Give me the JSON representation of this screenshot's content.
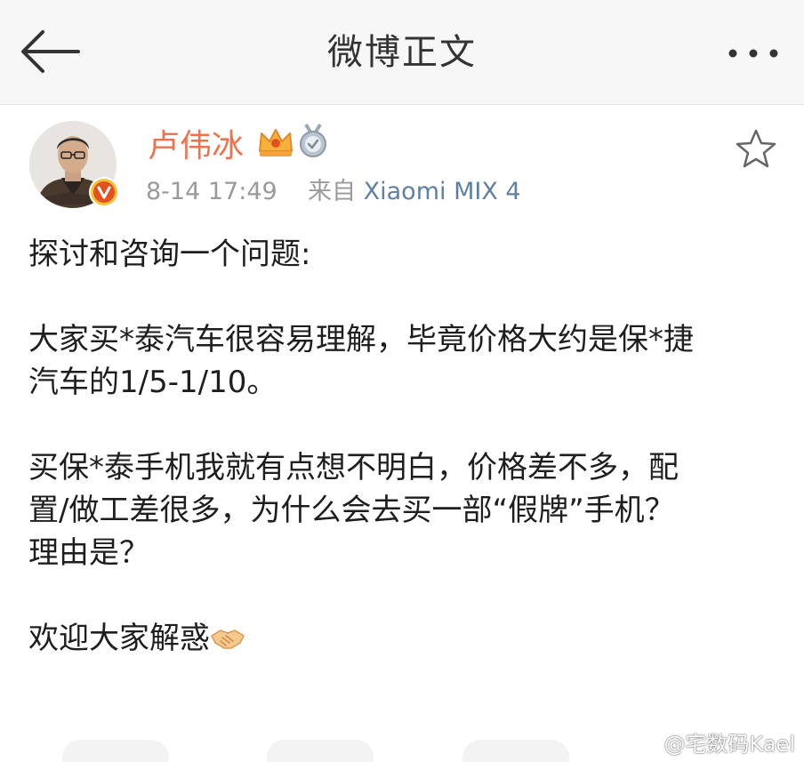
{
  "header": {
    "title": "微博正文",
    "back_icon": "back-arrow-icon",
    "more_icon": "more-dots-icon"
  },
  "post": {
    "author": {
      "name": "卢伟冰",
      "badges": [
        "vip-crown-icon",
        "medal-icon"
      ],
      "verified": true
    },
    "time": "8-14 17:49",
    "source_prefix": "来自",
    "source": "Xiaomi MIX 4",
    "lines": [
      "探讨和咨询一个问题:",
      "",
      "大家买*泰汽车很容易理解，毕竟价格大约是保*捷",
      "汽车的1/5-1/10。",
      "",
      "买保*泰手机我就有点想不明白，价格差不多，配",
      "置/做工差很多，为什么会去买一部“假牌”手机？",
      "理由是？",
      "",
      "欢迎大家解惑"
    ],
    "closing_emoji": "handshake-icon"
  },
  "watermark": "@宅数码Kael",
  "colors": {
    "name": "#eb7350",
    "source": "#5f7fa3",
    "meta": "#9a9a9a",
    "header_bg": "#f7f7f7"
  }
}
